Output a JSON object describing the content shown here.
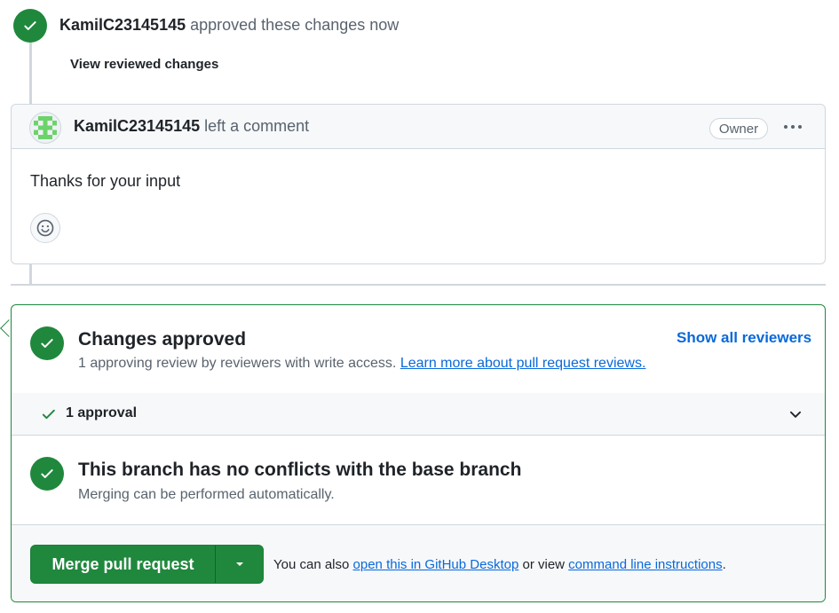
{
  "approval_event": {
    "author": "KamilC23145145",
    "action": "approved these changes now",
    "view_link": "View reviewed changes"
  },
  "comment": {
    "author": "KamilC23145145",
    "action": "left a comment",
    "badge": "Owner",
    "body": "Thanks for your input"
  },
  "merge": {
    "approved_title": "Changes approved",
    "approved_sub": "1 approving review by reviewers with write access.",
    "approved_link": "Learn more about pull request reviews.",
    "show_reviewers": "Show all reviewers",
    "approval_count": "1 approval",
    "conflict_title": "This branch has no conflicts with the base branch",
    "conflict_sub": "Merging can be performed automatically.",
    "merge_button": "Merge pull request",
    "footer_prefix": "You can also",
    "footer_link1": "open this in GitHub Desktop",
    "footer_mid": "or view",
    "footer_link2": "command line instructions",
    "footer_suffix": "."
  },
  "colors": {
    "success": "#1f883d",
    "link": "#0969da",
    "border": "#d0d7de",
    "muted": "#59636e"
  }
}
